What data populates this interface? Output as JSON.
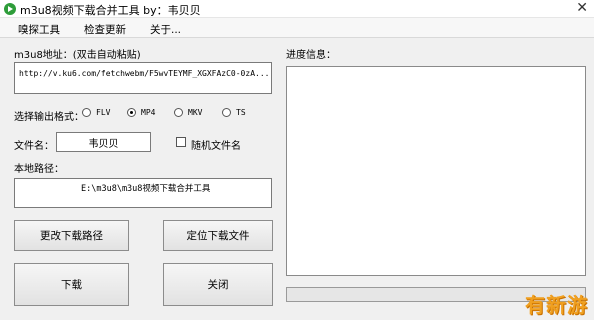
{
  "window": {
    "title": "m3u8视频下载合并工具 by：韦贝贝",
    "close_glyph": "✕"
  },
  "menu": [
    "嗅探工具",
    "检查更新",
    "关于..."
  ],
  "url": {
    "label": "m3u8地址：(双击自动粘贴)",
    "value": "http://v.ku6.com/fetchwebm/F5wvTEYMF_XGXFAzC0-0zA...m3u8"
  },
  "format": {
    "label": "选择输出格式：",
    "options": [
      "FLV",
      "MP4",
      "MKV",
      "TS"
    ],
    "selected": "MP4"
  },
  "filename": {
    "label": "文件名：",
    "value": "韦贝贝"
  },
  "random_name": {
    "label": "随机文件名",
    "checked": false
  },
  "local_path": {
    "label": "本地路径：",
    "value": "E:\\m3u8\\m3u8视频下载合并工具"
  },
  "buttons": {
    "change_path": "更改下载路径",
    "locate_file": "定位下载文件",
    "download": "下载",
    "close": "关闭"
  },
  "progress": {
    "label": "进度信息：",
    "value": 0
  },
  "watermark": "有新游"
}
